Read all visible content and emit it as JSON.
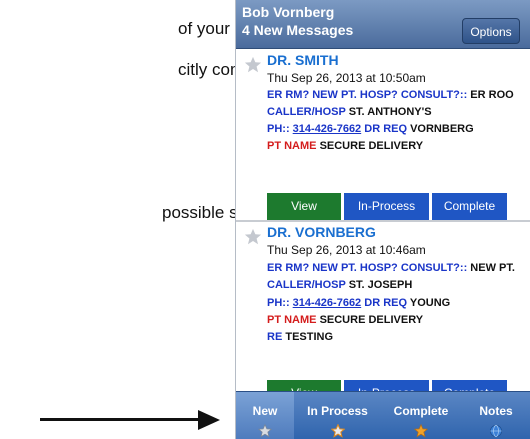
{
  "doc_text": {
    "line1": "of your messages",
    "line2": "citly communicate",
    "line3": "possible states."
  },
  "header": {
    "user": "Bob Vornberg",
    "count": "4 New Messages",
    "options_label": "Options"
  },
  "messages": [
    {
      "name": "DR. SMITH",
      "date": "Thu Sep 26, 2013 at 10:50am",
      "question_label": "ER RM? NEW PT. HOSP? CONSULT?::",
      "question_value": "ER ROO",
      "caller_label": "CALLER/HOSP",
      "caller_value": "ST. ANTHONY'S",
      "phone_label": "PH::",
      "phone_value": "314-426-7662",
      "dr_req_label": "DR REQ",
      "dr_req_value": "VORNBERG",
      "pt_label": "PT NAME",
      "pt_value": "SECURE DELIVERY",
      "re_label": "",
      "re_value": ""
    },
    {
      "name": "DR. VORNBERG",
      "date": "Thu Sep 26, 2013 at 10:46am",
      "question_label": "ER RM? NEW PT. HOSP? CONSULT?::",
      "question_value": "NEW PT.",
      "caller_label": "CALLER/HOSP",
      "caller_value": "ST. JOSEPH",
      "phone_label": "PH::",
      "phone_value": "314-426-7662",
      "dr_req_label": "DR REQ",
      "dr_req_value": "YOUNG",
      "pt_label": "PT NAME",
      "pt_value": "SECURE DELIVERY",
      "re_label": "RE",
      "re_value": "TESTING"
    }
  ],
  "actions": {
    "view": "View",
    "in_process": "In-Process",
    "complete": "Complete"
  },
  "tabs": {
    "new": "New",
    "in_process": "In Process",
    "complete": "Complete",
    "notes": "Notes"
  },
  "colors": {
    "nav_bar": "#4a6b9c",
    "view_button": "#1d7a2e",
    "action_button": "#1f56c4",
    "doctor_name": "#1a6fd0",
    "field_label_blue": "#1a35c8",
    "field_label_red": "#d41c1c"
  },
  "icons": {
    "message_star": "star-icon",
    "tab_new": "star-icon",
    "tab_in_process": "star-icon",
    "tab_complete": "star-icon",
    "tab_notes": "globe-icon",
    "arrow": "arrow-right-icon"
  }
}
